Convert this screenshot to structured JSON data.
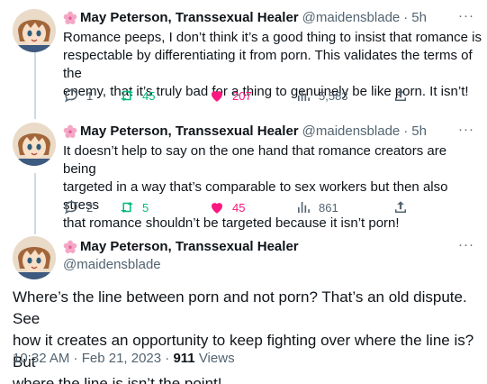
{
  "tweets": [
    {
      "author": {
        "name": "May Peterson, Transsexual Healer",
        "handle": "@maidensblade",
        "avatar_icon": "anime-avatar",
        "badge_icon": "cherry-blossom-icon"
      },
      "time": "5h",
      "text_lines": [
        "Romance peeps, I don’t think it’s a good thing to insist that romance is",
        "respectable by differentiating it from porn. This validates the terms of the",
        "enemy, that it’s truly bad for a thing to genuinely be like porn. It isn’t!"
      ],
      "stats": {
        "replies": "1",
        "retweets": "45",
        "likes": "207",
        "views": "5,583"
      }
    },
    {
      "author": {
        "name": "May Peterson, Transsexual Healer",
        "handle": "@maidensblade",
        "avatar_icon": "anime-avatar",
        "badge_icon": "cherry-blossom-icon"
      },
      "time": "5h",
      "text_lines": [
        "It doesn’t help to say on the one hand that romance creators are being",
        "targeted in a way that’s comparable to sex workers but then also stress",
        "that romance shouldn’t be targeted because it isn’t porn!"
      ],
      "stats": {
        "replies": "2",
        "retweets": "5",
        "likes": "45",
        "views": "861"
      }
    }
  ],
  "main_tweet": {
    "author": {
      "name": "May Peterson, Transsexual Healer",
      "handle": "@maidensblade",
      "avatar_icon": "anime-avatar",
      "badge_icon": "cherry-blossom-icon"
    },
    "text_lines": [
      "Where’s the line between porn and not porn? That’s an old dispute. See",
      "how it creates an opportunity to keep fighting over where the line is? But",
      "where the line is isn’t the point!"
    ],
    "timestamp": "10:32 AM · Feb 21, 2023 · ",
    "views_count": "911",
    "views_label": " Views"
  },
  "separator": "·",
  "colors": {
    "text": "#0f1419",
    "secondary": "#536471",
    "retweet": "#00ba7c",
    "like": "#f91880",
    "thread_line": "#cfd9de"
  }
}
